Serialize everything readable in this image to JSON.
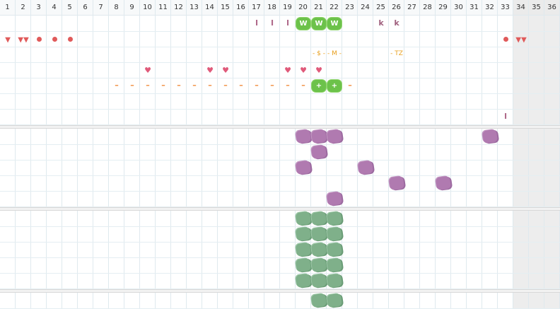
{
  "columns": [
    "1",
    "2",
    "3",
    "4",
    "5",
    "6",
    "7",
    "8",
    "9",
    "10",
    "11",
    "12",
    "13",
    "14",
    "15",
    "16",
    "17",
    "18",
    "19",
    "20",
    "21",
    "22",
    "23",
    "24",
    "25",
    "26",
    "27",
    "28",
    "29",
    "30",
    "31",
    "32",
    "33",
    "34",
    "35",
    "36"
  ],
  "shaded_columns": [
    "34",
    "35",
    "36"
  ],
  "top_section": {
    "bars": [
      {
        "col": "17",
        "label": "I"
      },
      {
        "col": "18",
        "label": "I"
      },
      {
        "col": "19",
        "label": "I"
      },
      {
        "col": "33",
        "row": 6,
        "label": "I"
      }
    ],
    "w_badges": [
      {
        "col": "20",
        "label": "W"
      },
      {
        "col": "21",
        "label": "W"
      },
      {
        "col": "22",
        "label": "W"
      }
    ],
    "k_marks": [
      {
        "col": "25",
        "label": "k"
      },
      {
        "col": "26",
        "label": "k"
      }
    ],
    "dots_row": {
      "drops": [
        "1",
        "2",
        "34"
      ],
      "circles": [
        "3",
        "4",
        "5",
        "33"
      ]
    },
    "annotations": [
      {
        "col": "21",
        "text": "- $ -"
      },
      {
        "col": "22",
        "text": "- M -"
      },
      {
        "col": "26",
        "text": "- TZ"
      }
    ],
    "hearts": [
      "10",
      "14",
      "15",
      "19",
      "20",
      "21"
    ],
    "dashes": [
      "8",
      "9",
      "10",
      "11",
      "12",
      "13",
      "14",
      "15",
      "16",
      "17",
      "18",
      "19",
      "20",
      "23"
    ],
    "plus_badges": [
      {
        "col": "21",
        "label": "+"
      },
      {
        "col": "22",
        "label": "+"
      }
    ]
  },
  "purple_section": [
    {
      "row": 0,
      "cols": [
        "20",
        "21",
        "22",
        "32"
      ]
    },
    {
      "row": 1,
      "cols": [
        "21"
      ]
    },
    {
      "row": 2,
      "cols": [
        "20",
        "24"
      ]
    },
    {
      "row": 3,
      "cols": [
        "26",
        "29"
      ]
    },
    {
      "row": 4,
      "cols": [
        "22"
      ]
    }
  ],
  "green_section": {
    "rows": 5,
    "cols": [
      "20",
      "21",
      "22"
    ]
  },
  "bottom_section": {
    "cols": [
      "21",
      "22"
    ]
  },
  "colors": {
    "accent_green": "#6cc24a",
    "purple": "#b07ab0",
    "sage": "#7fb08a",
    "red": "#e05a5a",
    "orange": "#f08a3a",
    "gold": "#e8a020"
  }
}
